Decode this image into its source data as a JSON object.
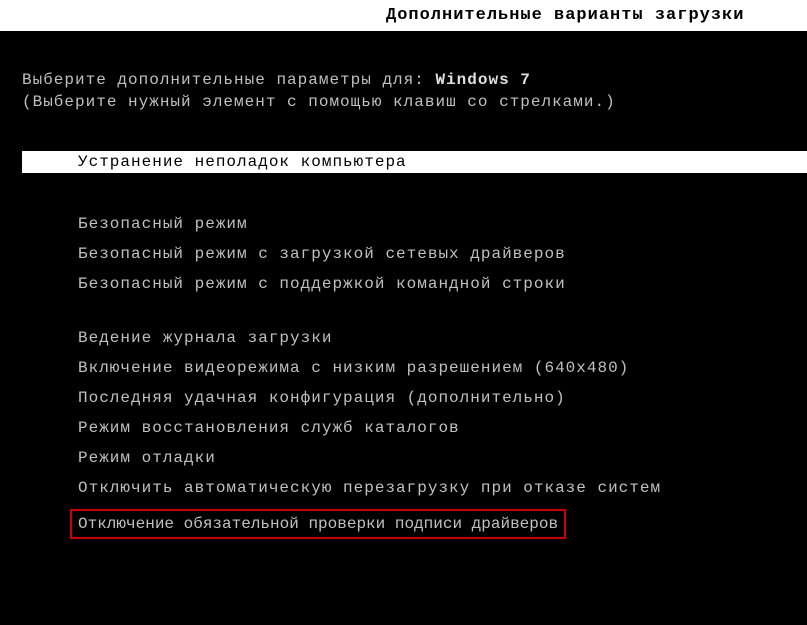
{
  "header": {
    "title": "Дополнительные варианты загрузки"
  },
  "prompt": {
    "text": "Выберите дополнительные параметры для:",
    "os": "Windows 7"
  },
  "hint": "(Выберите нужный элемент с помощью клавиш со стрелками.)",
  "selected": {
    "label": "Устранение неполадок компьютера"
  },
  "options_group1": [
    "Безопасный режим",
    "Безопасный режим с загрузкой сетевых драйверов",
    "Безопасный режим с поддержкой командной строки"
  ],
  "options_group2": [
    "Ведение журнала загрузки",
    "Включение видеорежима с низким разрешением (640x480)",
    "Последняя удачная конфигурация (дополнительно)",
    "Режим восстановления служб каталогов",
    "Режим отладки",
    "Отключить автоматическую перезагрузку при отказе систем"
  ],
  "highlighted_option": "Отключение обязательной проверки подписи драйверов"
}
